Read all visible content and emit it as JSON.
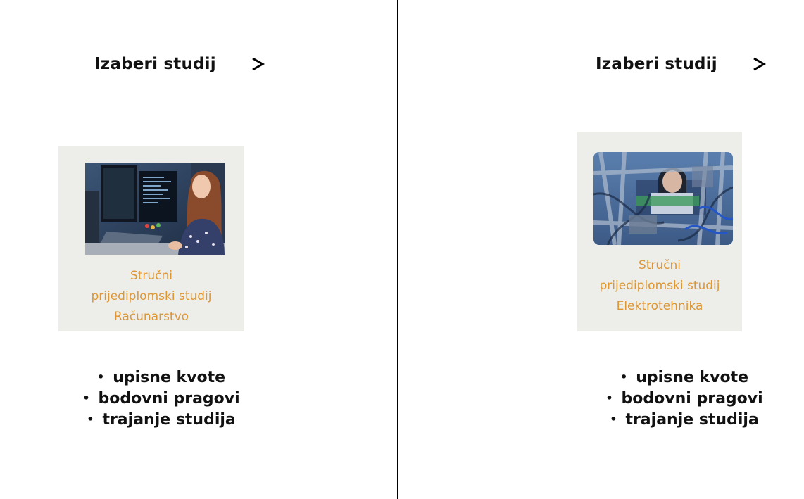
{
  "panels": [
    {
      "choose_label": "Izaberi studij",
      "card": {
        "title_line1": "Stručni",
        "title_line2": "prijediplomski studij",
        "title_line3": "Računarstvo",
        "image_icon": "photo-computer-student-icon"
      },
      "features": [
        "upisne kvote",
        "bodovni pragovi",
        "trajanje studija"
      ]
    },
    {
      "choose_label": "Izaberi studij",
      "card": {
        "title_line1": "Stručni",
        "title_line2": "prijediplomski studij",
        "title_line3": "Elektrotehnika",
        "image_icon": "photo-electronics-lab-icon"
      },
      "features": [
        "upisne kvote",
        "bodovni pragovi",
        "trajanje studija"
      ]
    }
  ],
  "colors": {
    "card_background": "#ededea",
    "card_title": "#dd9633",
    "text": "#111111",
    "divider": "#000000"
  }
}
